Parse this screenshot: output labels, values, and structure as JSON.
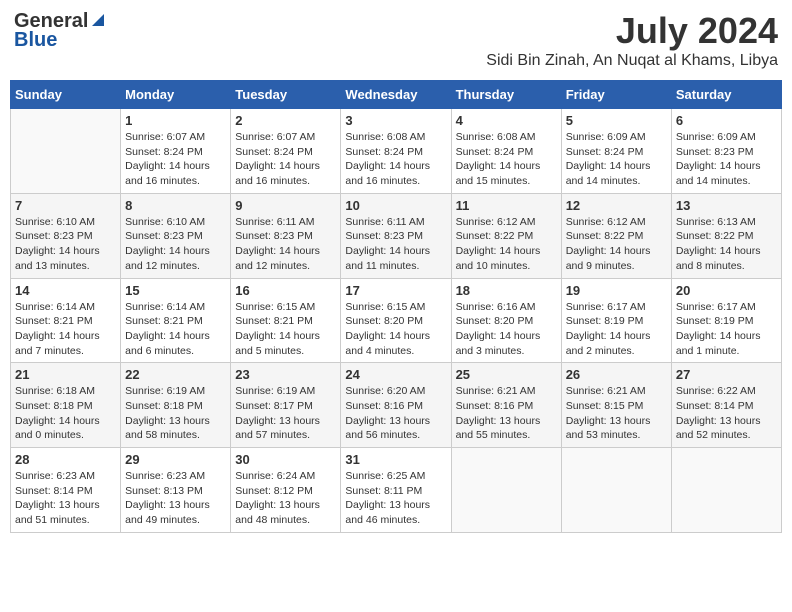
{
  "header": {
    "logo_general": "General",
    "logo_blue": "Blue",
    "month": "July 2024",
    "location": "Sidi Bin Zinah, An Nuqat al Khams, Libya"
  },
  "days_of_week": [
    "Sunday",
    "Monday",
    "Tuesday",
    "Wednesday",
    "Thursday",
    "Friday",
    "Saturday"
  ],
  "weeks": [
    [
      {
        "day": "",
        "info": ""
      },
      {
        "day": "1",
        "info": "Sunrise: 6:07 AM\nSunset: 8:24 PM\nDaylight: 14 hours\nand 16 minutes."
      },
      {
        "day": "2",
        "info": "Sunrise: 6:07 AM\nSunset: 8:24 PM\nDaylight: 14 hours\nand 16 minutes."
      },
      {
        "day": "3",
        "info": "Sunrise: 6:08 AM\nSunset: 8:24 PM\nDaylight: 14 hours\nand 16 minutes."
      },
      {
        "day": "4",
        "info": "Sunrise: 6:08 AM\nSunset: 8:24 PM\nDaylight: 14 hours\nand 15 minutes."
      },
      {
        "day": "5",
        "info": "Sunrise: 6:09 AM\nSunset: 8:24 PM\nDaylight: 14 hours\nand 14 minutes."
      },
      {
        "day": "6",
        "info": "Sunrise: 6:09 AM\nSunset: 8:23 PM\nDaylight: 14 hours\nand 14 minutes."
      }
    ],
    [
      {
        "day": "7",
        "info": "Sunrise: 6:10 AM\nSunset: 8:23 PM\nDaylight: 14 hours\nand 13 minutes."
      },
      {
        "day": "8",
        "info": "Sunrise: 6:10 AM\nSunset: 8:23 PM\nDaylight: 14 hours\nand 12 minutes."
      },
      {
        "day": "9",
        "info": "Sunrise: 6:11 AM\nSunset: 8:23 PM\nDaylight: 14 hours\nand 12 minutes."
      },
      {
        "day": "10",
        "info": "Sunrise: 6:11 AM\nSunset: 8:23 PM\nDaylight: 14 hours\nand 11 minutes."
      },
      {
        "day": "11",
        "info": "Sunrise: 6:12 AM\nSunset: 8:22 PM\nDaylight: 14 hours\nand 10 minutes."
      },
      {
        "day": "12",
        "info": "Sunrise: 6:12 AM\nSunset: 8:22 PM\nDaylight: 14 hours\nand 9 minutes."
      },
      {
        "day": "13",
        "info": "Sunrise: 6:13 AM\nSunset: 8:22 PM\nDaylight: 14 hours\nand 8 minutes."
      }
    ],
    [
      {
        "day": "14",
        "info": "Sunrise: 6:14 AM\nSunset: 8:21 PM\nDaylight: 14 hours\nand 7 minutes."
      },
      {
        "day": "15",
        "info": "Sunrise: 6:14 AM\nSunset: 8:21 PM\nDaylight: 14 hours\nand 6 minutes."
      },
      {
        "day": "16",
        "info": "Sunrise: 6:15 AM\nSunset: 8:21 PM\nDaylight: 14 hours\nand 5 minutes."
      },
      {
        "day": "17",
        "info": "Sunrise: 6:15 AM\nSunset: 8:20 PM\nDaylight: 14 hours\nand 4 minutes."
      },
      {
        "day": "18",
        "info": "Sunrise: 6:16 AM\nSunset: 8:20 PM\nDaylight: 14 hours\nand 3 minutes."
      },
      {
        "day": "19",
        "info": "Sunrise: 6:17 AM\nSunset: 8:19 PM\nDaylight: 14 hours\nand 2 minutes."
      },
      {
        "day": "20",
        "info": "Sunrise: 6:17 AM\nSunset: 8:19 PM\nDaylight: 14 hours\nand 1 minute."
      }
    ],
    [
      {
        "day": "21",
        "info": "Sunrise: 6:18 AM\nSunset: 8:18 PM\nDaylight: 14 hours\nand 0 minutes."
      },
      {
        "day": "22",
        "info": "Sunrise: 6:19 AM\nSunset: 8:18 PM\nDaylight: 13 hours\nand 58 minutes."
      },
      {
        "day": "23",
        "info": "Sunrise: 6:19 AM\nSunset: 8:17 PM\nDaylight: 13 hours\nand 57 minutes."
      },
      {
        "day": "24",
        "info": "Sunrise: 6:20 AM\nSunset: 8:16 PM\nDaylight: 13 hours\nand 56 minutes."
      },
      {
        "day": "25",
        "info": "Sunrise: 6:21 AM\nSunset: 8:16 PM\nDaylight: 13 hours\nand 55 minutes."
      },
      {
        "day": "26",
        "info": "Sunrise: 6:21 AM\nSunset: 8:15 PM\nDaylight: 13 hours\nand 53 minutes."
      },
      {
        "day": "27",
        "info": "Sunrise: 6:22 AM\nSunset: 8:14 PM\nDaylight: 13 hours\nand 52 minutes."
      }
    ],
    [
      {
        "day": "28",
        "info": "Sunrise: 6:23 AM\nSunset: 8:14 PM\nDaylight: 13 hours\nand 51 minutes."
      },
      {
        "day": "29",
        "info": "Sunrise: 6:23 AM\nSunset: 8:13 PM\nDaylight: 13 hours\nand 49 minutes."
      },
      {
        "day": "30",
        "info": "Sunrise: 6:24 AM\nSunset: 8:12 PM\nDaylight: 13 hours\nand 48 minutes."
      },
      {
        "day": "31",
        "info": "Sunrise: 6:25 AM\nSunset: 8:11 PM\nDaylight: 13 hours\nand 46 minutes."
      },
      {
        "day": "",
        "info": ""
      },
      {
        "day": "",
        "info": ""
      },
      {
        "day": "",
        "info": ""
      }
    ]
  ]
}
